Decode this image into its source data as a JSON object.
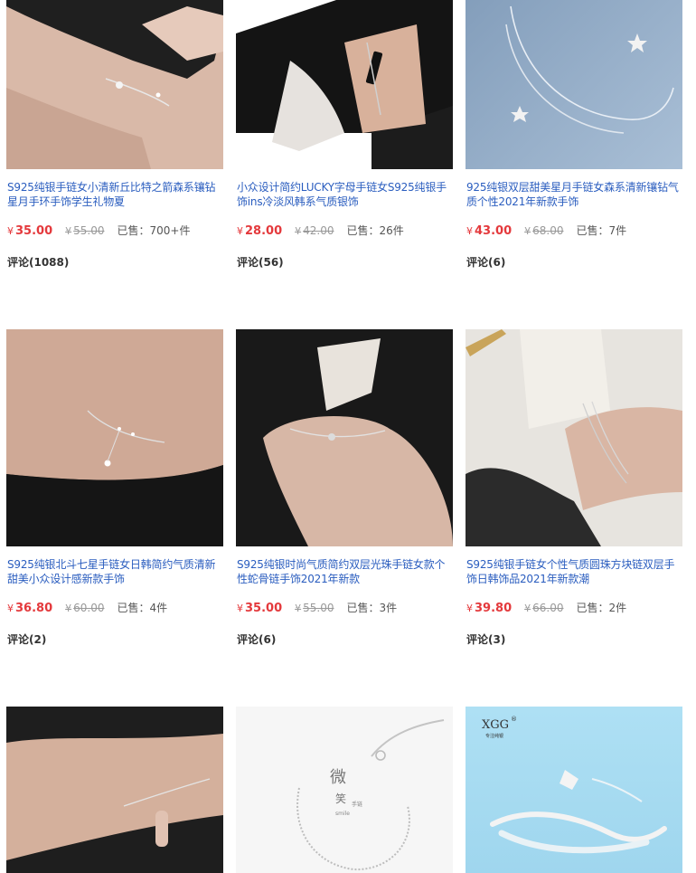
{
  "products": [
    {
      "title": "S925纯银手链女小清新丘比特之箭森系镶钻星月手环手饰学生礼物夏",
      "currency": "¥",
      "price": "35.00",
      "original_price": "55.00",
      "sold": "已售：700+件",
      "reviews": "评论(1088)",
      "image": "bracelet-on-wrist-moon-charm-photo"
    },
    {
      "title": "小众设计简约LUCKY字母手链女S925纯银手饰ins冷淡风韩系气质银饰",
      "currency": "¥",
      "price": "28.00",
      "original_price": "42.00",
      "sold": "已售：26件",
      "reviews": "评论(56)",
      "image": "bracelet-on-wrist-black-bar-photo"
    },
    {
      "title": "925纯银双层甜美星月手链女森系清新镶钻气质个性2021年新款手饰",
      "currency": "¥",
      "price": "43.00",
      "original_price": "68.00",
      "sold": "已售：7件",
      "reviews": "评论(6)",
      "image": "double-chain-star-moon-bracelet-photo"
    },
    {
      "title": "S925纯银北斗七星手链女日韩简约气质清新甜美小众设计感新款手饰",
      "currency": "¥",
      "price": "36.80",
      "original_price": "60.00",
      "sold": "已售：4件",
      "reviews": "评论(2)",
      "image": "big-dipper-bracelet-on-wrist-photo"
    },
    {
      "title": "S925纯银时尚气质简约双层光珠手链女款个性蛇骨链手饰2021年新款",
      "currency": "¥",
      "price": "35.00",
      "original_price": "55.00",
      "sold": "已售：3件",
      "reviews": "评论(6)",
      "image": "bead-bracelet-on-hand-photo"
    },
    {
      "title": "S925纯银手链女个性气质圆珠方块链双层手饰日韩饰品2021年新款潮",
      "currency": "¥",
      "price": "39.80",
      "original_price": "66.00",
      "sold": "已售：2件",
      "reviews": "评论(3)",
      "image": "paperclip-chain-bracelet-photo"
    },
    {
      "title": "",
      "image": "thin-bar-bracelet-on-wrist-photo"
    },
    {
      "title": "",
      "image": "bead-chain-bracelet-flatlay-photo",
      "image_text": [
        "微",
        "笑",
        "手链",
        "smile"
      ]
    },
    {
      "title": "",
      "image": "fish-bangle-product-photo",
      "image_text": [
        "XGG",
        "®",
        "专注纯银"
      ]
    }
  ],
  "colors": {
    "title": "#2a5dbf",
    "price": "#e4393c",
    "old_price": "#999999"
  }
}
